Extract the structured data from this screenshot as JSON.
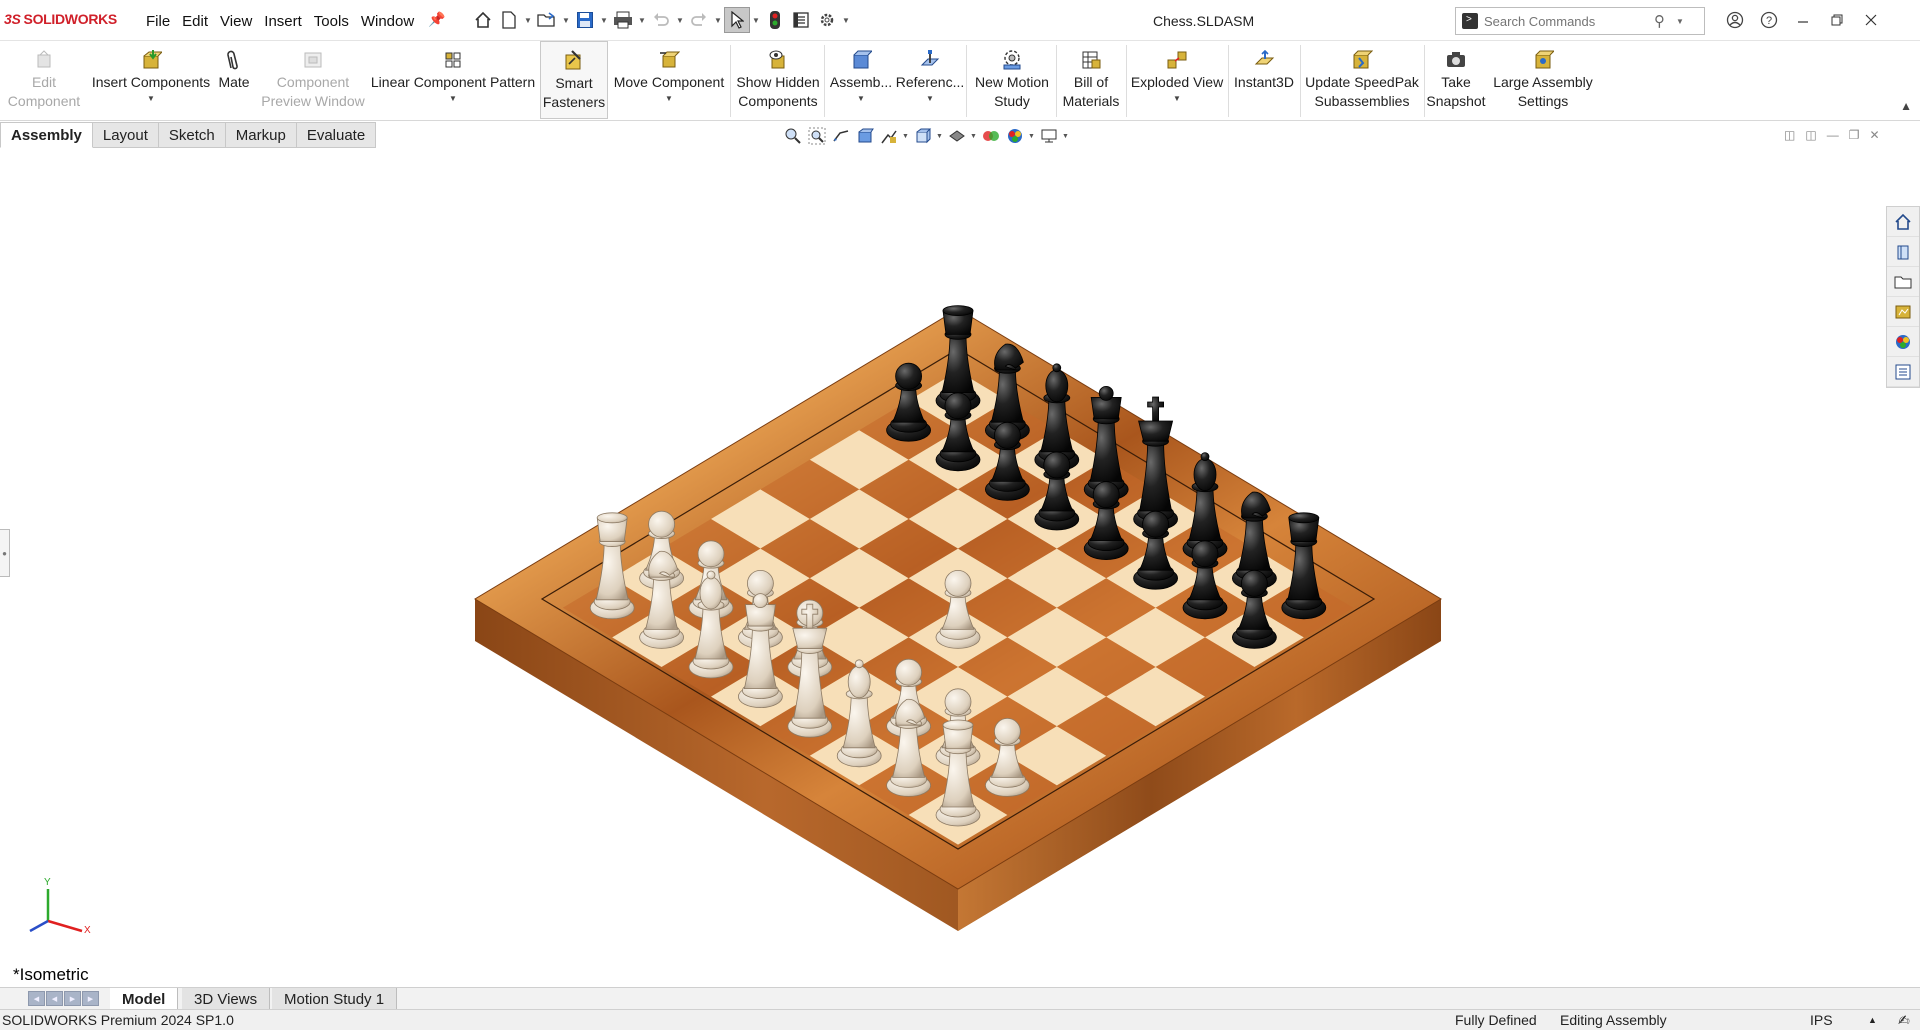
{
  "app": {
    "logo_ds": "3S",
    "logo_text": "SOLIDWORKS",
    "menus": [
      "File",
      "Edit",
      "View",
      "Insert",
      "Tools",
      "Window"
    ],
    "document_title": "Chess.SLDASM",
    "search_placeholder": "Search Commands"
  },
  "ribbon": {
    "edit_component": [
      "Edit",
      "Component"
    ],
    "insert_components": "Insert Components",
    "mate": "Mate",
    "component_preview": [
      "Component",
      "Preview Window"
    ],
    "linear_pattern": "Linear Component Pattern",
    "smart_fasteners": [
      "Smart",
      "Fasteners"
    ],
    "move_component": "Move Component",
    "show_hidden": [
      "Show Hidden",
      "Components"
    ],
    "assembly": "Assemb...",
    "reference": "Referenc...",
    "motion_study": [
      "New Motion",
      "Study"
    ],
    "bom": [
      "Bill of",
      "Materials"
    ],
    "exploded_view": "Exploded View",
    "instant3d": "Instant3D",
    "speedpak": [
      "Update SpeedPak",
      "Subassemblies"
    ],
    "snapshot": [
      "Take",
      "Snapshot"
    ],
    "large_assembly": [
      "Large Assembly",
      "Settings"
    ]
  },
  "tabs": [
    "Assembly",
    "Layout",
    "Sketch",
    "Markup",
    "Evaluate"
  ],
  "viewport": {
    "view_label": "*Isometric",
    "triad": {
      "y": "Y",
      "x": "X"
    }
  },
  "bottom_tabs": [
    "Model",
    "3D Views",
    "Motion Study 1"
  ],
  "status": {
    "product": "SOLIDWORKS Premium 2024 SP1.0",
    "state": "Fully Defined",
    "mode": "Editing Assembly",
    "units": "IPS"
  },
  "colors": {
    "brand": "#d0202a",
    "wood_dark": "#a4521c",
    "wood_light": "#d9893f",
    "square_light": "#f7dfb8",
    "square_dark": "#c4672a",
    "white_piece": "#e8dccd",
    "black_piece": "#1c1c1c"
  }
}
